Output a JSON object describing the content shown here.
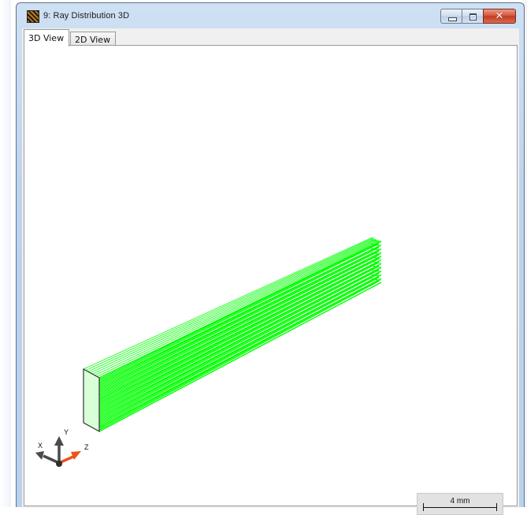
{
  "window": {
    "title": "9: Ray Distribution 3D",
    "controls": {
      "minimize": "minimize",
      "maximize": "maximize",
      "close": "✕"
    }
  },
  "tabs": [
    {
      "label": "3D View",
      "active": true
    },
    {
      "label": "2D View",
      "active": false
    }
  ],
  "viewport": {
    "ray_color": "#00ff00",
    "aperture_outline_color": "#333333",
    "scale_bar": {
      "label": "4 mm"
    },
    "axes": {
      "x_label": "X",
      "y_label": "Y",
      "z_label": "Z",
      "z_color": "#e8551a",
      "xy_color": "#4a4a4a"
    }
  },
  "colors": {
    "title_bar": "#bcd3ee",
    "close_button": "#c8432a",
    "background": "#ffffff"
  }
}
